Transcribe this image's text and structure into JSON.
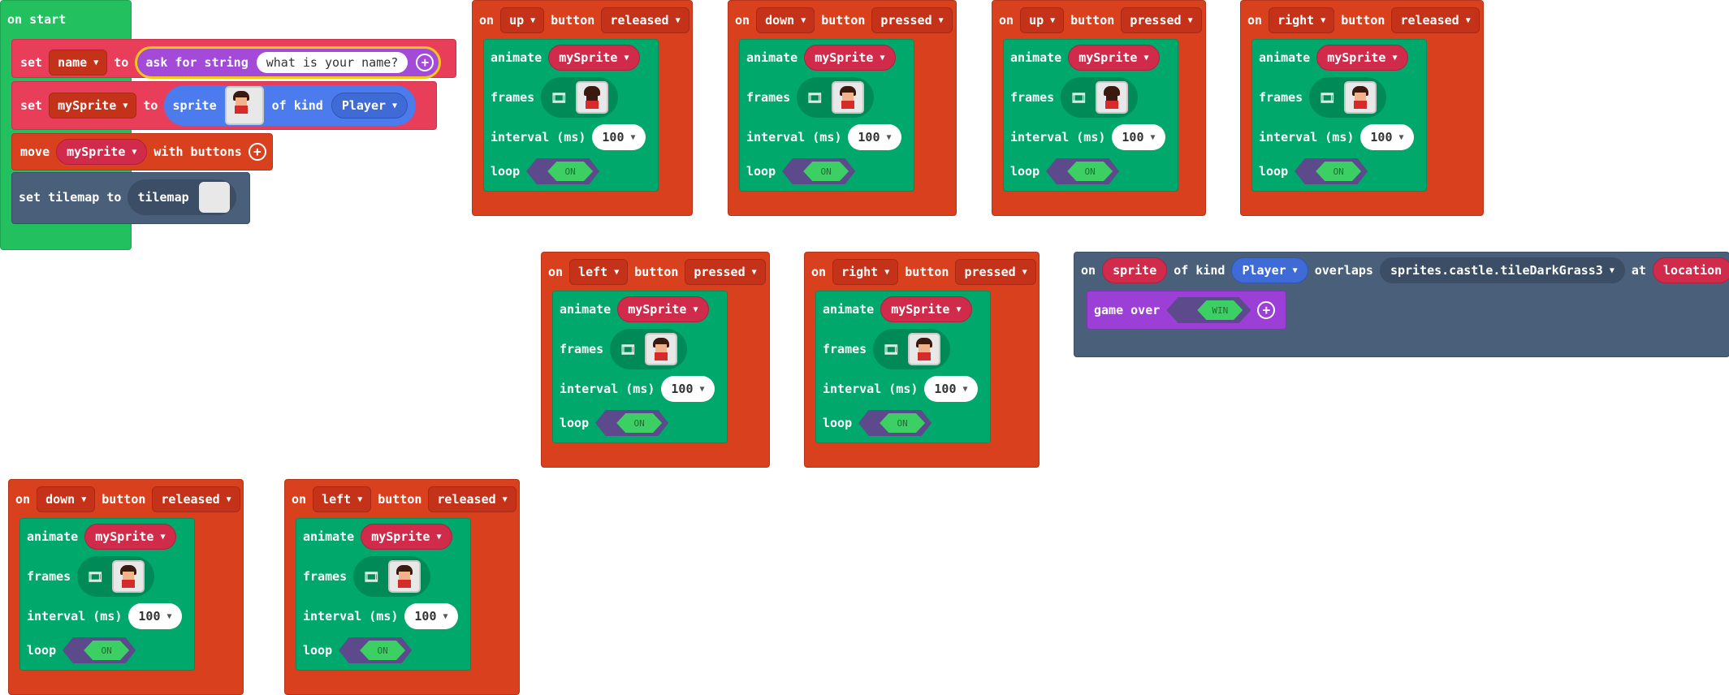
{
  "on_start": {
    "title": "on start",
    "set1": {
      "set": "set",
      "var": "name",
      "to": "to",
      "ask": "ask for string",
      "prompt": "what is your name?"
    },
    "set2": {
      "set": "set",
      "var": "mySprite",
      "to": "to",
      "sprite": "sprite",
      "of_kind": "of kind",
      "kind": "Player"
    },
    "move": {
      "move": "move",
      "var": "mySprite",
      "with": "with buttons"
    },
    "tilemap": {
      "label": "set tilemap to",
      "value": "tilemap"
    }
  },
  "labels": {
    "on": "on",
    "button": "button",
    "animate": "animate",
    "frames": "frames",
    "interval": "interval (ms)",
    "loop": "loop",
    "toggle_on": "ON"
  },
  "handlers": [
    {
      "key": "up",
      "event": "released",
      "var": "mySprite",
      "interval": "100"
    },
    {
      "key": "down",
      "event": "pressed",
      "var": "mySprite",
      "interval": "100"
    },
    {
      "key": "up",
      "event": "pressed",
      "var": "mySprite",
      "interval": "100"
    },
    {
      "key": "right",
      "event": "released",
      "var": "mySprite",
      "interval": "100"
    },
    {
      "key": "left",
      "event": "pressed",
      "var": "mySprite",
      "interval": "100"
    },
    {
      "key": "right",
      "event": "pressed",
      "var": "mySprite",
      "interval": "100"
    },
    {
      "key": "down",
      "event": "released",
      "var": "mySprite",
      "interval": "100"
    },
    {
      "key": "left",
      "event": "released",
      "var": "mySprite",
      "interval": "100"
    }
  ],
  "overlap": {
    "on": "on",
    "sprite": "sprite",
    "of_kind": "of kind",
    "kind": "Player",
    "overlaps": "overlaps",
    "tile": "sprites.castle.tileDarkGrass3",
    "at": "at",
    "location": "location",
    "game_over": "game over",
    "win": "WIN"
  },
  "colors": {
    "event_orange": "#d9411e",
    "animate_green": "#00a86b",
    "on_start_green": "#23c060",
    "sprite_blue": "#4b7bec",
    "var_red": "#d02b4b",
    "tilemap_slate": "#4a5f7a",
    "game_purple": "#9c3fd6",
    "string_purple": "#a34bd8"
  }
}
